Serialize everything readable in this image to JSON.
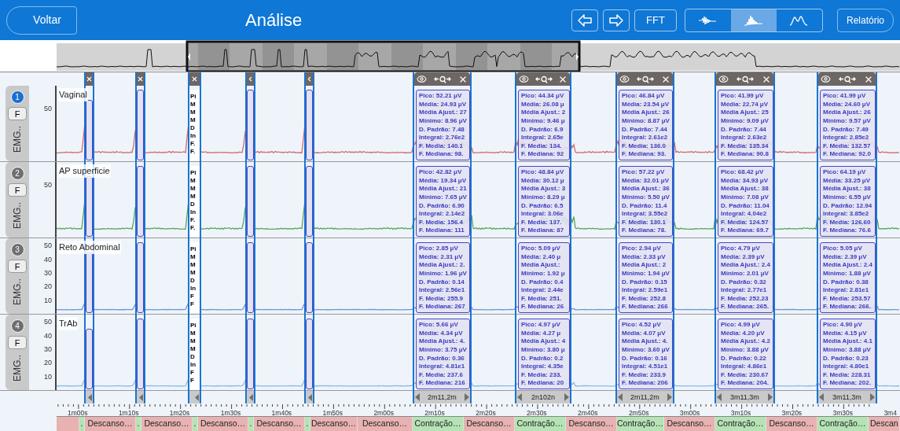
{
  "header": {
    "back": "Voltar",
    "title": "Análise",
    "fft": "FFT",
    "report": "Relatório",
    "views": [
      {
        "selected": false
      },
      {
        "selected": true
      },
      {
        "selected": false
      }
    ]
  },
  "markers": [
    {
      "kind": "narrow",
      "closable": true
    },
    {
      "kind": "narrow",
      "closable": true
    },
    {
      "kind": "clipped",
      "closable": true
    },
    {
      "kind": "narrow",
      "closable": false
    },
    {
      "kind": "narrow",
      "closable": false
    },
    {
      "kind": "stats",
      "duration": "2m11,2m"
    },
    {
      "kind": "stats",
      "duration": "2n102n"
    },
    {
      "kind": "stats",
      "duration": "2m11,2m"
    },
    {
      "kind": "stats",
      "duration": "3m11,3m"
    },
    {
      "kind": "stats",
      "duration": "3m11,3m"
    }
  ],
  "channels": [
    {
      "number": "1",
      "selected": true,
      "name": "Vaginal",
      "filter": "F",
      "type": "EMG..",
      "color": "#d26a6a",
      "yticks": [
        "50"
      ],
      "readouts": [
        [
          "Pi",
          "M",
          "M",
          "M",
          "D",
          "In",
          "F.",
          "F."
        ],
        [
          "Pico: 52.21 μV",
          "Média: 24.93 μV",
          "Média Ajust.: 27",
          "Mínimo: 8.96 μV",
          "D. Padrão: 7.48",
          "Integral: 2.76e2",
          "F. Media: 140.1",
          "F. Mediana: 98."
        ],
        [
          "Pico: 44.34 μV",
          "Média: 26.08 μ",
          "Média Ajust.: 2",
          "Mínimo: 9.46 μ",
          "D. Padrão: 6.9",
          "Integral: 2.65e",
          "F. Media: 134.",
          "F. Mediana: 92"
        ],
        [
          "Pico: 46.84 μV",
          "Média: 23.54 μV",
          "Média Ajust.: 26",
          "Mínimo: 8.87 μV",
          "D. Padrão: 7.44",
          "Integral: 2.61e2",
          "F. Media: 136.0",
          "F. Mediana: 93."
        ],
        [
          "Pico: 41.99 μV",
          "Média: 22.74 μV",
          "Média Ajust.: 25",
          "Mínimo: 9.09 μV",
          "D. Padrão: 7.44",
          "Integral: 2.63e2",
          "F. Media: 135.34",
          "F. Mediana: 90.8"
        ],
        [
          "Pico: 41.99 μV",
          "Média: 24.60 μV",
          "Média Ajust.: 26",
          "Mínimo: 9.57 μV",
          "D. Padrão: 7.49",
          "Integral: 2.85e2",
          "F. Media: 132.57",
          "F. Mediana: 92.0"
        ]
      ]
    },
    {
      "number": "2",
      "selected": false,
      "name": "AP superficie",
      "filter": "F",
      "type": "EMG..",
      "color": "#5aa55a",
      "yticks": [
        "50"
      ],
      "readouts": [
        [
          "Pi",
          "M",
          "M",
          "M",
          "D",
          "In",
          "F.",
          "F."
        ],
        [
          "Pico: 42.82 μV",
          "Média: 19.34 μV",
          "Média Ajust.: 21",
          "Mínimo: 7.65 μV",
          "D. Padrão: 6.90",
          "Integral: 2.14e2",
          "F. Media: 156.4",
          "F. Mediana: 111"
        ],
        [
          "Pico: 48.84 μV",
          "Média: 30.12 μ",
          "Média Ajust.: 3",
          "Mínimo: 8.29 μ",
          "D. Padrão: 6.5",
          "Integral: 3.06e",
          "F. Media: 137.",
          "F. Mediana: 87"
        ],
        [
          "Pico: 57.22 μV",
          "Média: 32.01 μV",
          "Média Ajust.: 36",
          "Mínimo: 5.50 μV",
          "D. Padrão: 11.4",
          "Integral: 3.55e2",
          "F. Media: 130.1",
          "F. Mediana: 78."
        ],
        [
          "Pico: 68.42 μV",
          "Média: 34.93 μV",
          "Média Ajust.: 38",
          "Mínimo: 7.08 μV",
          "D. Padrão: 11.04",
          "Integral: 4.04e2",
          "F. Media: 124.57",
          "F. Mediana: 69.7"
        ],
        [
          "Pico: 64.19 μV",
          "Média: 33.25 μV",
          "Média Ajust.: 38",
          "Mínimo: 6.55 μV",
          "D. Padrão: 12.94",
          "Integral: 3.85e2",
          "F. Media: 126.60",
          "F. Mediana: 76.6"
        ]
      ]
    },
    {
      "number": "3",
      "selected": false,
      "name": "Reto Abdominal",
      "filter": "F",
      "type": "EMG..",
      "color": "#6f93d6",
      "yticks": [
        "50",
        "40",
        "30",
        "20",
        "10"
      ],
      "readouts": [
        [
          "Pi",
          "M",
          "M",
          "M",
          "D",
          "In",
          "F",
          "F"
        ],
        [
          "Pico: 2.85 μV",
          "Média: 2.31 μV",
          "Média Ajust.: 2.",
          "Mínimo: 1.96 μV",
          "D. Padrão: 0.14",
          "Integral: 2.56e1",
          "F. Media: 255.9",
          "F. Mediana: 267"
        ],
        [
          "Pico: 5.09 μV",
          "Média: 2.40 μ",
          "Média Ajust.:",
          "Mínimo: 1.92 μ",
          "D. Padrão: 0.4",
          "Integral: 2.44e",
          "F. Media: 251.",
          "F. Mediana: 26"
        ],
        [
          "Pico: 2.94 μV",
          "Média: 2.33 μV",
          "Média Ajust.: 2",
          "Mínimo: 1.94 μV",
          "D. Padrão: 0.15",
          "Integral: 2.59e1",
          "F. Media: 252.8",
          "F. Mediana: 266"
        ],
        [
          "Pico: 4.79 μV",
          "Média: 2.39 μV",
          "Média Ajust.: 2.4",
          "Mínimo: 2.01 μV",
          "D. Padrão: 0.32",
          "Integral: 2.77e1",
          "F. Media: 252.23",
          "F. Mediana: 265."
        ],
        [
          "Pico: 5.05 μV",
          "Média: 2.39 μV",
          "Média Ajust.: 2.4",
          "Mínimo: 1.88 μV",
          "D. Padrão: 0.38",
          "Integral: 2.81e1",
          "F. Media: 253.57",
          "F. Mediana: 266."
        ]
      ]
    },
    {
      "number": "4",
      "selected": false,
      "name": "TrAb",
      "filter": "F",
      "type": "EMG..",
      "color": "#86bbe6",
      "yticks": [
        "50",
        "40",
        "30",
        "20",
        "10"
      ],
      "readouts": [
        [
          "Pi",
          "M",
          "M",
          "M",
          "D",
          "In",
          "F",
          "F"
        ],
        [
          "Pico: 5.66 μV",
          "Média: 4.34 μV",
          "Média Ajust.: 4.",
          "Mínimo: 3.75 μV",
          "D. Padrão: 0.36",
          "Integral: 4.81e1",
          "F. Media: 237.6",
          "F. Mediana: 216"
        ],
        [
          "Pico: 4.97 μV",
          "Média: 4.27 μ",
          "Média Ajust.: 4",
          "Mínimo: 3.80 μ",
          "D. Padrão: 0.2",
          "Integral: 4.35e",
          "F. Media: 233.",
          "F. Mediana: 20"
        ],
        [
          "Pico: 4.52 μV",
          "Média: 4.07 μV",
          "Média Ajust.: 4.",
          "Mínimo: 3.60 μV",
          "D. Padrão: 0.16",
          "Integral: 4.51e1",
          "F. Media: 233.9",
          "F. Mediana: 206"
        ],
        [
          "Pico: 4.99 μV",
          "Média: 4.20 μV",
          "Média Ajust.: 4.2",
          "Mínimo: 3.88 μV",
          "D. Padrão: 0.22",
          "Integral: 4.86e1",
          "F. Media: 230.67",
          "F. Mediana: 204."
        ],
        [
          "Pico: 4.90 μV",
          "Média: 4.15 μV",
          "Média Ajust.: 4.1",
          "Mínimo: 3.88 μV",
          "D. Padrão: 0.23",
          "Integral: 4.80e1",
          "F. Media: 228.31",
          "F. Mediana: 202."
        ]
      ]
    }
  ],
  "time_labels": [
    "1m00s",
    "1m10s",
    "1m20s",
    "1m30s",
    "1m40s",
    "1m50s",
    "2m00s",
    "2m10s",
    "2m20s",
    "2m30s",
    "2m40s",
    "2m50s",
    "3m00s",
    "3m10s",
    "3m20s",
    "3m30s",
    "3m4"
  ],
  "segments": [
    {
      "kind": "rest"
    },
    {
      "kind": "contraction",
      "label": "."
    },
    {
      "kind": "rest",
      "label": "Descanso…"
    },
    {
      "kind": "contraction",
      "label": "."
    },
    {
      "kind": "rest",
      "label": "Descanso…"
    },
    {
      "kind": "contraction",
      "label": "."
    },
    {
      "kind": "rest",
      "label": "Descanso…"
    },
    {
      "kind": "contraction",
      "label": "."
    },
    {
      "kind": "rest",
      "label": "Descanso…"
    },
    {
      "kind": "contraction",
      "label": "."
    },
    {
      "kind": "rest",
      "label": "Descanso…"
    },
    {
      "kind": "rest",
      "label": "Descanso…"
    },
    {
      "kind": "contraction",
      "label": "Contração…"
    },
    {
      "kind": "rest",
      "label": "Descanso…"
    },
    {
      "kind": "contraction",
      "label": "Contração…"
    },
    {
      "kind": "rest",
      "label": "Descanso…"
    },
    {
      "kind": "contraction",
      "label": "Contração…"
    },
    {
      "kind": "rest",
      "label": "Descanso…"
    },
    {
      "kind": "contraction",
      "label": "Contração…"
    },
    {
      "kind": "rest",
      "label": "Descanso…"
    },
    {
      "kind": "contraction",
      "label": "Contração…"
    },
    {
      "kind": "rest",
      "label": "Descan"
    }
  ]
}
